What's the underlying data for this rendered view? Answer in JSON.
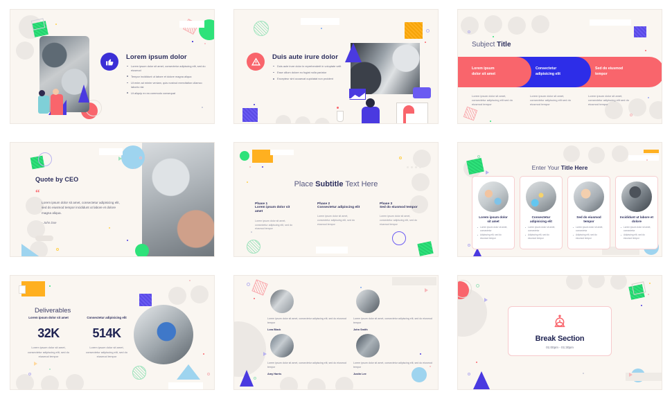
{
  "meta": {
    "background": "#ffffff",
    "slide_bg": "#faf6f1",
    "accent_navy": "#2b2d5c",
    "accent_coral": "#f9656c",
    "accent_blue": "#2d2de8",
    "accent_green": "#2ee27a",
    "accent_orange": "#ffb020",
    "accent_purple": "#6a5bf2"
  },
  "slides": [
    {
      "id": "slide-1-icon-bullets",
      "title": "Lorem ipsum dolor",
      "icon": "thumbs-up-icon",
      "icon_color": "#3b2fd6",
      "bullets": [
        "Lorem ipsum dolor sit amet, consectetur adipiscing elit, sed do eiusmod",
        "Tempor incididunt ut labore et dolore magna aliqua",
        "Ut enim ad minim veniam, quis nostrud exercitation ullamco laboris nisi",
        "Ut aliquip ex ea commodo consequat"
      ]
    },
    {
      "id": "slide-2-warning-bullets",
      "title": "Duis aute irure dolor",
      "icon": "warning-icon",
      "icon_color": "#f9656c",
      "bullets": [
        "Duis aute irure dolor in reprehenderit in voluptate velit",
        "Esse cillum dolore eu fugiat nulla pariatur",
        "Excepteur sint occaecat cupidatat non proident"
      ]
    },
    {
      "id": "slide-3-subject-pills",
      "title_light": "Subject ",
      "title_bold": "Title",
      "pills": [
        {
          "label": "Lorem ipsum\ndolor sit amet",
          "color": "#f9656c"
        },
        {
          "label": "Consectetur\nadipisicing elit",
          "color": "#2d2de8"
        },
        {
          "label": "Sed do eiusmod\ntempor",
          "color": "#f9656c"
        }
      ],
      "captions": [
        "Lorem ipsum dolor sit amet, consectetur adipiscing elit sed do eiusmod tempor",
        "Lorem ipsum dolor sit amet, consectetur adipiscing elit sed do eiusmod tempor",
        "Lorem ipsum dolor sit amet, consectetur adipiscing elit sed do eiusmod tempor"
      ]
    },
    {
      "id": "slide-4-quote",
      "title": "Quote by CEO",
      "quote_mark": "“",
      "quote": "Lorem ipsum dolor sit amet, consectetur adipisicing elit, sed do eiusmod tempor incididunt ut labore et dolore magna aliqua.",
      "attribution": "- John Doe"
    },
    {
      "id": "slide-5-phases",
      "title_parts": [
        "Place ",
        "Subtitle",
        " Text Here"
      ],
      "phases": [
        {
          "label": "Phase 1",
          "heading": "Lorem ipsum dolor sit amet",
          "body": "Lorem ipsum dolor sit amet, consectetur adipiscing elit, sed do eiusmod tempor"
        },
        {
          "label": "Phase 2",
          "heading": "Consectetur adipiscing elit",
          "body": "Lorem ipsum dolor sit amet, consectetur adipiscing elit, sed do eiusmod tempor"
        },
        {
          "label": "Phase 3",
          "heading": "Sed do eiusmod tempor",
          "body": "Lorem ipsum dolor sit amet, consectetur adipiscing elit, sed do eiusmod tempor"
        }
      ]
    },
    {
      "id": "slide-6-four-cards",
      "title_light": "Enter Your ",
      "title_bold": "Title Here",
      "cards": [
        {
          "title": "Lorem ipsum dolor sit amet",
          "bullets": [
            "Lorem ipsum dolor sit amet, consectetur",
            "Adipiscing elit, sed do eiusmod tempor"
          ]
        },
        {
          "title": "Consectetur adipisicing elit",
          "bullets": [
            "Lorem ipsum dolor sit amet, consectetur",
            "Adipiscing elit, sed do eiusmod tempor"
          ]
        },
        {
          "title": "Sed do eiusmod tempor",
          "bullets": [
            "Lorem ipsum dolor sit amet, consectetur",
            "Adipiscing elit, sed do eiusmod tempor"
          ]
        },
        {
          "title": "Incididunt ut labore et dolore",
          "bullets": [
            "Lorem ipsum dolor sit amet, consectetur",
            "Adipiscing elit, sed do eiusmod tempor"
          ]
        }
      ]
    },
    {
      "id": "slide-7-deliverables",
      "title": "Deliverables",
      "stats": [
        {
          "heading": "Lorem ipsum dolor sit amet",
          "value": "32K",
          "body": "Lorem ipsum dolor sit amet, consectetur adipiscing elit, sed do eiusmod tempor"
        },
        {
          "heading": "Consectetur adipisicing elit",
          "value": "514K",
          "body": "Lorem ipsum dolor sit amet, consectetur adipiscing elit, sed do eiusmod tempor"
        }
      ]
    },
    {
      "id": "slide-8-team",
      "members": [
        {
          "text": "Lorem ipsum dolor sit amet, consectetur adipiscing elit, sed do eiusmod tempor",
          "name": "Lora Black"
        },
        {
          "text": "Lorem ipsum dolor sit amet, consectetur adipiscing elit, sed do eiusmod tempor",
          "name": "John Smith"
        },
        {
          "text": "Lorem ipsum dolor sit amet, consectetur adipiscing elit, sed do eiusmod tempor",
          "name": "Amy Harris"
        },
        {
          "text": "Lorem ipsum dolor sit amet, consectetur adipiscing elit, sed do eiusmod tempor",
          "name": "Justin Lee"
        }
      ]
    },
    {
      "id": "slide-9-break",
      "icon": "alarm-clock-icon",
      "title": "Break Section",
      "time": "01:00pm - 01:30pm"
    }
  ]
}
